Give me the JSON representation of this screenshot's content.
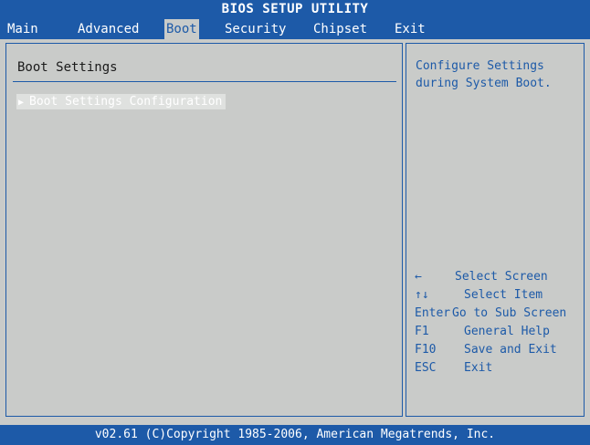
{
  "title_bar": {
    "title": "BIOS SETUP UTILITY"
  },
  "menu": {
    "tabs": [
      {
        "label": "Main",
        "active": false
      },
      {
        "label": "Advanced",
        "active": false
      },
      {
        "label": "Boot",
        "active": true
      },
      {
        "label": "Security",
        "active": false
      },
      {
        "label": "Chipset",
        "active": false
      },
      {
        "label": "Exit",
        "active": false
      }
    ]
  },
  "main": {
    "title": "Boot Settings",
    "items": [
      {
        "label": "Boot Settings Configuration",
        "arrow_icon": "triangle-right-icon",
        "selected": true
      }
    ]
  },
  "help": {
    "description": "Configure Settings during System Boot.",
    "keys": [
      {
        "key": "←",
        "desc": "Select Screen"
      },
      {
        "key": "↑↓",
        "desc": "Select Item"
      },
      {
        "key": "Enter",
        "desc": "Go to Sub Screen"
      },
      {
        "key": "F1",
        "desc": "General Help"
      },
      {
        "key": "F10",
        "desc": "Save and Exit"
      },
      {
        "key": "ESC",
        "desc": "Exit"
      }
    ]
  },
  "footer": {
    "text": "v02.61 (C)Copyright 1985-2006, American Megatrends, Inc."
  },
  "colors": {
    "bar_blue": "#1d5aa8",
    "background_gray": "#c9cbc9",
    "highlight_gray": "#dfe1df",
    "text_white": "#ffffff"
  }
}
